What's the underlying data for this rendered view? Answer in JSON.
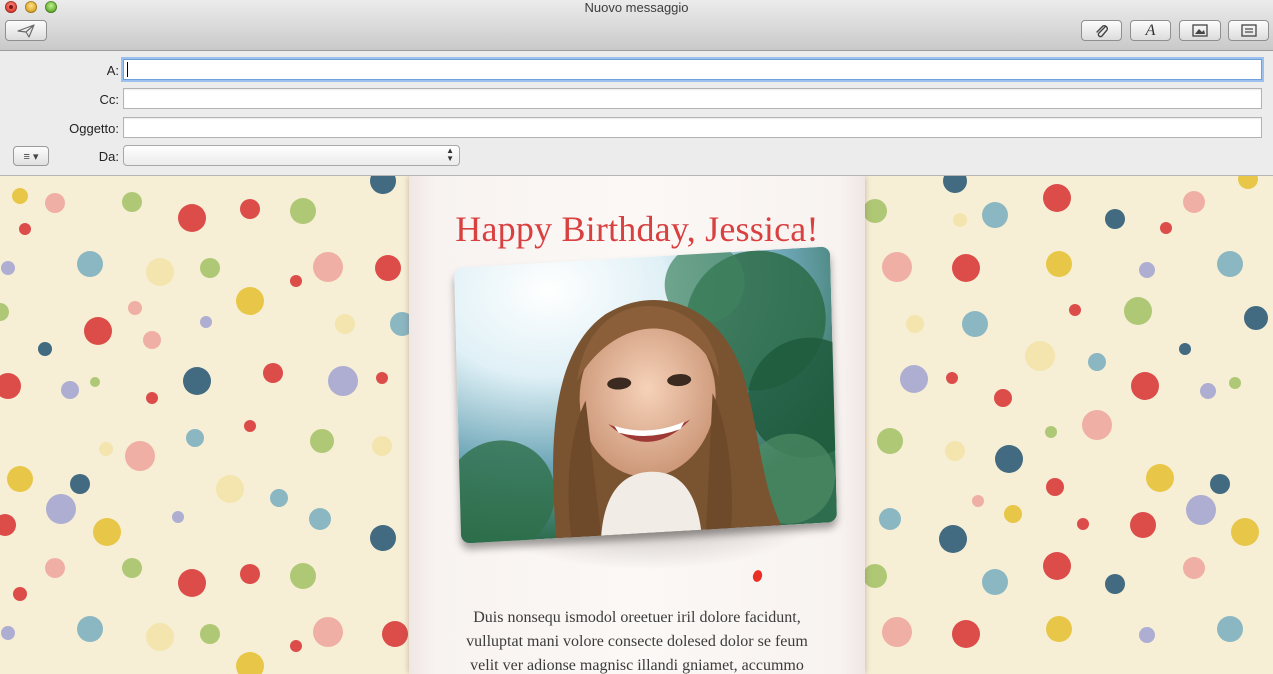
{
  "window": {
    "title": "Nuovo messaggio"
  },
  "toolbar": {
    "buttons": [
      {
        "icon": "send-icon"
      },
      {
        "icon": "paperclip-icon"
      },
      {
        "icon": "font-icon"
      },
      {
        "icon": "photo-browser-icon"
      },
      {
        "icon": "stationery-icon"
      }
    ],
    "font_glyph": "A"
  },
  "fields": {
    "to_label": "A:",
    "to_value": "",
    "cc_label": "Cc:",
    "cc_value": "",
    "subject_label": "Oggetto:",
    "subject_value": "",
    "from_label": "Da:",
    "from_value": "",
    "menu_glyph": "≡ ▾"
  },
  "stationery": {
    "title": "Happy Birthday, Jessica!",
    "body_lines": [
      "Duis nonsequ ismodol oreetuer iril dolore facidunt,",
      "vulluptat mani volore consecte dolesed dolor se feum",
      "velit ver adionse magnisc illandi gniamet, accummo"
    ],
    "title_color": "#d94040",
    "dot_colors": [
      "#d93b3b",
      "#f0a7a0",
      "#e7c238",
      "#a7c36a",
      "#7fb0c0",
      "#2f5b77",
      "#a6a6d2",
      "#f3e3a8"
    ]
  }
}
